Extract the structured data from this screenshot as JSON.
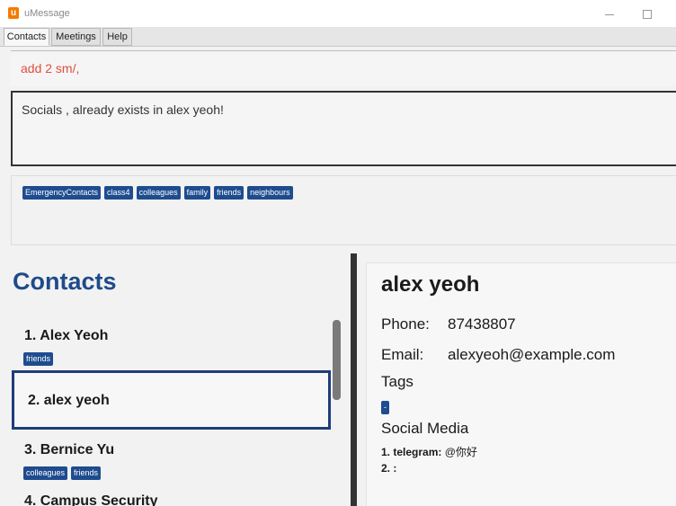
{
  "window": {
    "title": "uMessage",
    "logo_letter": "u",
    "accent": "#f57c00"
  },
  "tabs": [
    {
      "label": "Contacts",
      "active": true
    },
    {
      "label": "Meetings",
      "active": false
    },
    {
      "label": "Help",
      "active": false
    }
  ],
  "command": {
    "value": "add 2 sm/,"
  },
  "result": {
    "message": "Socials ,  already exists in alex yeoh!"
  },
  "all_tags": [
    "EmergencyContacts",
    "class4",
    "colleagues",
    "family",
    "friends",
    "neighbours"
  ],
  "contacts_panel": {
    "title": "Contacts",
    "items": [
      {
        "label": "1.  Alex Yeoh",
        "tags": [
          "friends"
        ],
        "selected": false
      },
      {
        "label": "2.  alex yeoh",
        "tags": [],
        "selected": true
      },
      {
        "label": "3.  Bernice Yu",
        "tags": [
          "colleagues",
          "friends"
        ],
        "selected": false
      },
      {
        "label": "4.  Campus Security",
        "tags": [],
        "selected": false
      }
    ]
  },
  "details": {
    "name": "alex yeoh",
    "phone_label": "Phone:",
    "phone": "87438807",
    "email_label": "Email:",
    "email": "alexyeoh@example.com",
    "tags_heading": "Tags",
    "tags": [
      "-"
    ],
    "social_heading": "Social Media",
    "socials": [
      {
        "index": "1. telegram:",
        "value": "@你好"
      },
      {
        "index": "2. :",
        "value": ""
      }
    ]
  },
  "colors": {
    "brand_blue": "#1f4b8a",
    "tag_bg": "#1e4c8f",
    "command_text": "#e04e3e"
  }
}
